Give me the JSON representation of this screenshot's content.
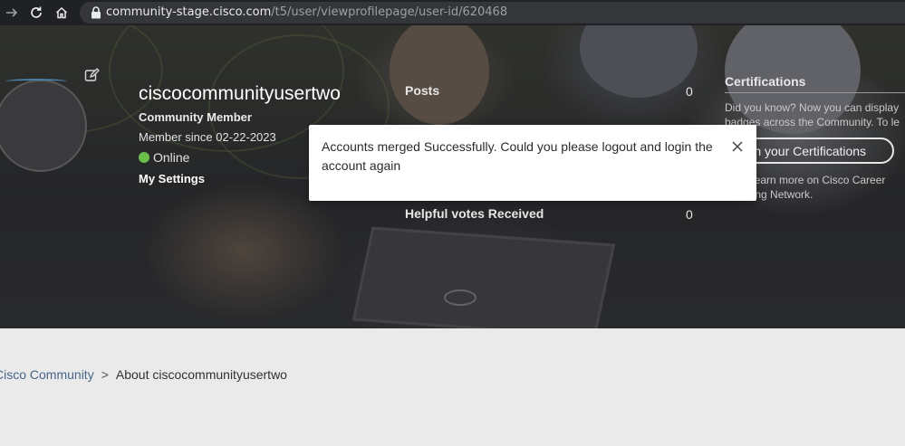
{
  "browser": {
    "url_host": "community-stage.cisco.com",
    "url_path": "/t5/user/viewprofilepage/user-id/620468"
  },
  "profile": {
    "name": "ciscocommunityusertwo",
    "role": "Community Member",
    "member_since": "Member since 02-22-2023",
    "status": "Online",
    "settings_link": "My Settings"
  },
  "stats": {
    "posts_label": "Posts",
    "posts_value": "0",
    "helpful_label": "Helpful votes Received",
    "helpful_value": "0"
  },
  "certifications": {
    "title": "Certifications",
    "text_line1": "Did you know? Now you can display",
    "text_line2": "badges across the Community. To le",
    "button_label": "Match your Certifications",
    "text_line3": "Or to learn more on Cisco Career",
    "text_line4": "Learning Network."
  },
  "breadcrumb": {
    "home": "Cisco Community",
    "separator": ">",
    "current": "About ciscocommunityusertwo"
  },
  "toast": {
    "message": "Accounts merged Successfully. Could you please logout and login the account again"
  },
  "colors": {
    "online": "#6abf4b",
    "link": "#4a6a8e"
  }
}
